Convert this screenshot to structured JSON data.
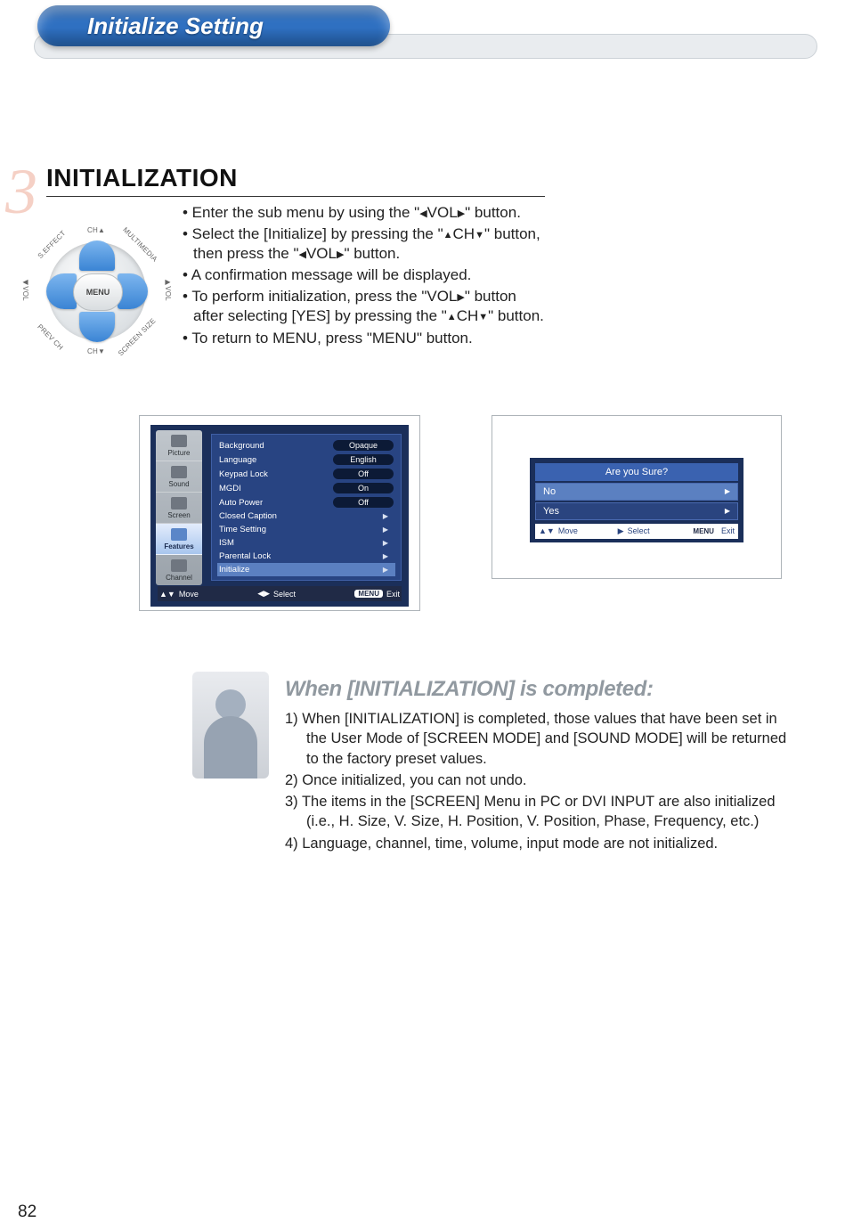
{
  "page_number": "82",
  "heading_pill": "Initialize Setting",
  "big_num": "3",
  "section_title": "INITIALIZATION",
  "remote": {
    "menu": "MENU",
    "ch_up": "CH",
    "ch_dn": "CH",
    "vol_l": "VOL",
    "vol_r": "VOL",
    "tl": "S.EFFECT",
    "tr": "MULTIMEDIA",
    "bl": "PREV CH",
    "br": "SCREEN SIZE"
  },
  "instructions": {
    "b1a": "• Enter the sub menu by using the \"",
    "b1b": "VOL",
    "b1c": "\" button.",
    "b2a": "• Select the [Initialize] by pressing the \"",
    "b2b": "CH",
    "b2c": "\" button, then press the \"",
    "b2d": "VOL",
    "b2e": "\" button.",
    "b3": "• A confirmation message will be displayed.",
    "b4a": "• To perform initialization, press the \"VOL",
    "b4b": "\" button after selecting [YES] by pressing the \"",
    "b4c": "CH",
    "b4d": "\" button.",
    "b5": "• To return to MENU, press \"MENU\" button."
  },
  "osd1": {
    "categories": [
      "Picture",
      "Sound",
      "Screen",
      "Features",
      "Channel"
    ],
    "active_index": 3,
    "rows": [
      {
        "label": "Background",
        "value": "Opaque",
        "type": "val"
      },
      {
        "label": "Language",
        "value": "English",
        "type": "val"
      },
      {
        "label": "Keypad Lock",
        "value": "Off",
        "type": "val"
      },
      {
        "label": "MGDI",
        "value": "On",
        "type": "val"
      },
      {
        "label": "Auto Power",
        "value": "Off",
        "type": "val"
      },
      {
        "label": "Closed Caption",
        "type": "sub"
      },
      {
        "label": "Time Setting",
        "type": "sub"
      },
      {
        "label": "ISM",
        "type": "sub"
      },
      {
        "label": "Parental Lock",
        "type": "sub"
      },
      {
        "label": "Initialize",
        "type": "sub",
        "selected": true
      }
    ],
    "foot": {
      "move": "Move",
      "select": "Select",
      "menu": "MENU",
      "exit": "Exit"
    }
  },
  "osd2": {
    "title": "Are you Sure?",
    "opt_no": "No",
    "opt_yes": "Yes",
    "foot": {
      "move": "Move",
      "select": "Select",
      "menu": "MENU",
      "exit": "Exit"
    }
  },
  "complete": {
    "heading": "When [INITIALIZATION] is completed:",
    "l1": "1)  When [INITIALIZATION] is completed, those values that have been set in the User Mode of [SCREEN MODE] and [SOUND MODE] will be returned to the factory preset values.",
    "l2": "2)  Once initialized, you can not undo.",
    "l3": "3)  The items in the [SCREEN] Menu in PC or DVI INPUT are also initialized (i.e., H. Size, V. Size, H. Position, V. Position, Phase, Frequency, etc.)",
    "l4": "4)  Language, channel, time, volume, input mode are not initialized."
  }
}
